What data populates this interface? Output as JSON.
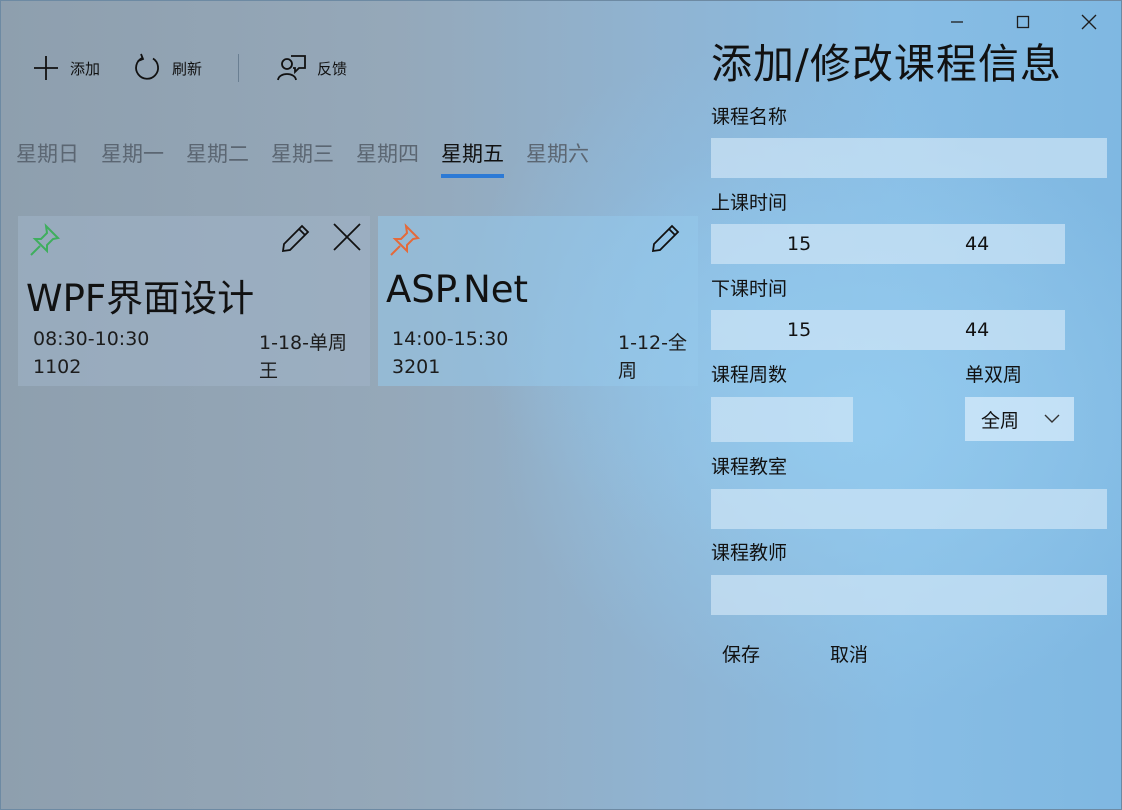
{
  "caption": {
    "minimize_icon": "minimize-icon",
    "maximize_icon": "maximize-icon",
    "close_icon": "close-icon"
  },
  "toolbar": {
    "add_label": "添加",
    "refresh_label": "刷新",
    "feedback_label": "反馈"
  },
  "tabs": [
    "星期日",
    "星期一",
    "星期二",
    "星期三",
    "星期四",
    "星期五",
    "星期六"
  ],
  "active_tab": "星期五",
  "courses": [
    {
      "pin_color": "#3fae5e",
      "title": "WPF界面设计",
      "time": "08:30-10:30",
      "weeks": "1-18-单周",
      "room": "1102",
      "teacher": "王"
    },
    {
      "pin_color": "#e46a3a",
      "title": "ASP.Net",
      "time": "14:00-15:30",
      "weeks": "1-12-全",
      "room": "3201",
      "teacher": "周"
    }
  ],
  "form": {
    "heading": "添加/修改课程信息",
    "name_label": "课程名称",
    "name_value": "",
    "start_label": "上课时间",
    "start_hour": "15",
    "start_minute": "44",
    "end_label": "下课时间",
    "end_hour": "15",
    "end_minute": "44",
    "weeks_label": "课程周数",
    "weeks_value": "",
    "parity_label": "单双周",
    "parity_value": "全周",
    "room_label": "课程教室",
    "room_value": "",
    "teacher_label": "课程教师",
    "teacher_value": "",
    "save_label": "保存",
    "cancel_label": "取消"
  },
  "colors": {
    "accent": "#2c7ad6"
  }
}
